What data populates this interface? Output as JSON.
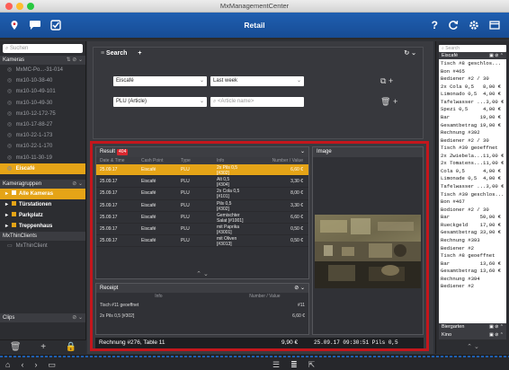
{
  "window": {
    "title": "MxManagementCenter"
  },
  "toolbar": {
    "title": "Retail"
  },
  "sidebar": {
    "search_placeholder": "Suchen",
    "cameras_header": "Kameras",
    "cameras": [
      {
        "label": "MxMC-Po...-31-014",
        "icon": "camera-icon"
      },
      {
        "label": "mx10-10-38-40",
        "icon": "camera-icon"
      },
      {
        "label": "mx10-10-49-101",
        "icon": "camera-icon"
      },
      {
        "label": "mx10-10-49-30",
        "icon": "camera-icon"
      },
      {
        "label": "mx10-12-172-75",
        "icon": "camera-icon"
      },
      {
        "label": "mx10-17-88-27",
        "icon": "camera-icon"
      },
      {
        "label": "mx10-22-1-173",
        "icon": "camera-icon"
      },
      {
        "label": "mx10-22-1-170",
        "icon": "camera-icon"
      },
      {
        "label": "mx10-11-30-19",
        "icon": "camera-icon"
      },
      {
        "label": "Eiscafé",
        "icon": "camera-icon",
        "selected": true
      }
    ],
    "groups_header": "Kameragruppen",
    "groups": [
      {
        "label": "Alle Kameras",
        "selected": true
      },
      {
        "label": "Türstationen"
      },
      {
        "label": "Parkplatz"
      },
      {
        "label": "Treppenhaus"
      }
    ],
    "clients_header": "MxThinClients",
    "clients": [
      {
        "label": "MxThinClient"
      }
    ],
    "clips_header": "Clips"
  },
  "search_panel": {
    "title": "Search",
    "add_icon": "+",
    "filter1": "Eiscafé",
    "filter2": "Last week",
    "filter3": "PLU (Article)",
    "filter4_placeholder": "<Article name>"
  },
  "result": {
    "title": "Result",
    "count": "404",
    "columns": [
      "Date & Time",
      "Cash Point",
      "Type",
      "Info",
      "Number / Value"
    ],
    "rows": [
      {
        "date": "25.09.17\n09:30:51",
        "cash": "Eiscafé",
        "type": "PLU",
        "info": "2x Pils 0,5\n[#302]",
        "value": "6,60 €",
        "selected": true
      },
      {
        "date": "25.09.17\n09:30:51",
        "cash": "Eiscafé",
        "type": "PLU",
        "info": "Alt 0,5\n[#304]",
        "value": "3,30 €"
      },
      {
        "date": "25.09.17\n12:27:33",
        "cash": "Eiscafé",
        "type": "PLU",
        "info": "2x Cola 0,5\n[#101]",
        "value": "8,00 €"
      },
      {
        "date": "25.09.17\n12:27:36",
        "cash": "Eiscafé",
        "type": "PLU",
        "info": "Pils 0,5\n[#302]",
        "value": "3,30 €"
      },
      {
        "date": "25.09.17\n12:28:02",
        "cash": "Eiscafé",
        "type": "PLU",
        "info": "Gemischter\nSalat [#1001]",
        "value": "6,60 €"
      },
      {
        "date": "25.09.17\n12:28:36",
        "cash": "Eiscafé",
        "type": "PLU",
        "info": "mit Paprika\n[#3001]",
        "value": "0,50 €"
      },
      {
        "date": "25.09.17\n12:28:37",
        "cash": "Eiscafé",
        "type": "PLU",
        "info": "mit Oliven\n[#3013]",
        "value": "0,50 €"
      }
    ]
  },
  "receipt": {
    "title": "Receipt",
    "columns": [
      "Info",
      "Number / Value"
    ],
    "lines": [
      {
        "info": "Tisch #11 geoeffnet",
        "value": "#11"
      },
      {
        "info": "2x Pils 0,5 [#302]",
        "value": "6,60 €"
      }
    ],
    "footer_label": "Rechnung #276, Table 11",
    "footer_amount": "9,90 €",
    "footer_timestamp": "25.09.17 09:30:51 Pils 0,5"
  },
  "image_pane": {
    "title": "Image"
  },
  "right_panel": {
    "search_placeholder": "Search",
    "header": "Eiscafé",
    "lines": [
      "Tisch #8 geschlos...",
      "Bon #465",
      "Bediener #2 / 30",
      "2x Cola 0,5   8,00 €",
      "Limonado 0,5  4,00 €",
      "Tafelwasser ...3,00 €",
      "Spezi 0,5     4,00 €",
      "Bar          19,00 €",
      "Gesamtbetrag 19,00 €",
      "Rechnung #392",
      "Bediener #2 / 30",
      "Tisch #39 geoeffnet",
      "2x Zwiebela...11,00 €",
      "2x Tomatens...11,00 €",
      "Cola 0,5      4,00 €",
      "Limonade 0,5  4,00 €",
      "Tafelwasser ...3,00 €",
      "Tisch #39 geschlos...",
      "Bon #467",
      "Bodioner #2 / 30",
      "Bar          50,00 €",
      "Rueckgeld    17,00 €",
      "Gesamtbetrag 33,00 €",
      "Rechnung #393",
      "Bediener #2",
      "Tisch #8 geoeffnet",
      "Bar          13,60 €",
      "Gesamtbetrag 13,60 €",
      "Rechnung #394",
      "Bediener #2"
    ],
    "sub_rows": [
      {
        "label": "Biergarten"
      },
      {
        "label": "Kino"
      }
    ]
  },
  "colors": {
    "accent": "#e5a417",
    "toolbar": "#1f5fb1",
    "highlight_border": "#c4161c",
    "badge": "#d9282f"
  }
}
